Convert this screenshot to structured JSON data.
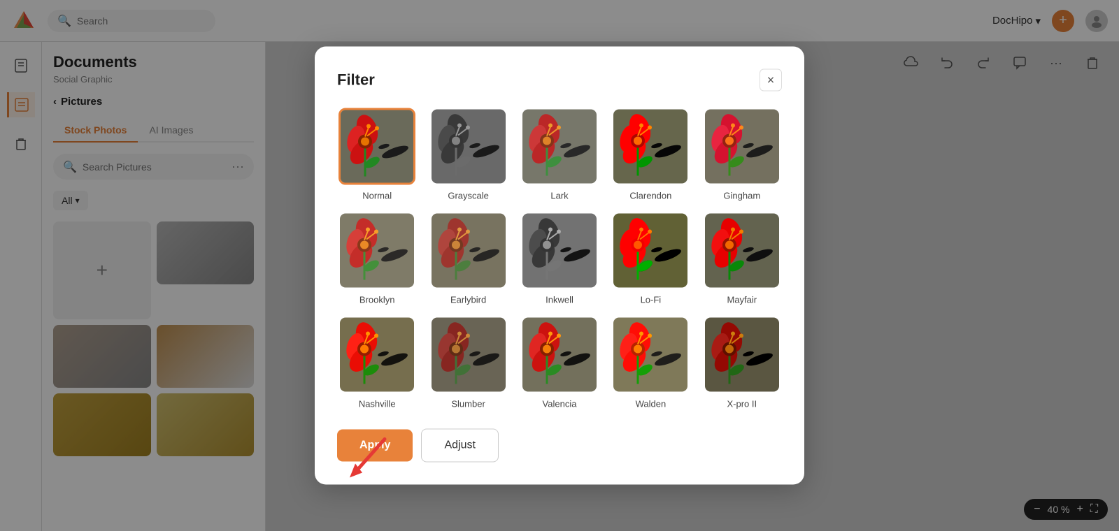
{
  "topbar": {
    "search_placeholder": "Search",
    "brand_name": "DocHipo",
    "brand_chevron": "▾",
    "add_icon": "+",
    "user_icon": "👤"
  },
  "sidebar": {
    "title": "Documents",
    "subtitle": "Social Graphic",
    "back_label": "Pictures",
    "tabs": [
      {
        "id": "stock",
        "label": "Stock Photos",
        "active": true
      },
      {
        "id": "ai",
        "label": "AI Images",
        "active": false
      }
    ],
    "search_placeholder": "Search Pictures",
    "filter_label": "All",
    "images": [
      {
        "id": "horse",
        "class": "img-horse"
      },
      {
        "id": "tiger",
        "class": "img-tiger"
      },
      {
        "id": "flower",
        "class": "img-flower"
      },
      {
        "id": "lion",
        "class": "img-lion"
      },
      {
        "id": "lioness",
        "class": "img-lioness"
      }
    ]
  },
  "modal": {
    "title": "Filter",
    "close_label": "×",
    "filters": [
      {
        "id": "normal",
        "label": "Normal",
        "css_class": "filter-normal",
        "selected": true
      },
      {
        "id": "grayscale",
        "label": "Grayscale",
        "css_class": "filter-grayscale",
        "selected": false
      },
      {
        "id": "lark",
        "label": "Lark",
        "css_class": "filter-lark",
        "selected": false
      },
      {
        "id": "clarendon",
        "label": "Clarendon",
        "css_class": "filter-clarendon",
        "selected": false
      },
      {
        "id": "gingham",
        "label": "Gingham",
        "css_class": "filter-gingham",
        "selected": false
      },
      {
        "id": "brooklyn",
        "label": "Brooklyn",
        "css_class": "filter-brooklyn",
        "selected": false
      },
      {
        "id": "earlybird",
        "label": "Earlybird",
        "css_class": "filter-earlybird",
        "selected": false
      },
      {
        "id": "inkwell",
        "label": "Inkwell",
        "css_class": "filter-inkwell",
        "selected": false
      },
      {
        "id": "lofi",
        "label": "Lo-Fi",
        "css_class": "filter-lofi",
        "selected": false
      },
      {
        "id": "mayfair",
        "label": "Mayfair",
        "css_class": "filter-mayfair",
        "selected": false
      },
      {
        "id": "nashville",
        "label": "Nashville",
        "css_class": "filter-nashville",
        "selected": false
      },
      {
        "id": "slumber",
        "label": "Slumber",
        "css_class": "filter-slumber",
        "selected": false
      },
      {
        "id": "valencia",
        "label": "Valencia",
        "css_class": "filter-valencia",
        "selected": false
      },
      {
        "id": "walden",
        "label": "Walden",
        "css_class": "filter-walden",
        "selected": false
      },
      {
        "id": "xpro2",
        "label": "X-pro II",
        "css_class": "filter-xpro2",
        "selected": false
      }
    ],
    "apply_label": "Apply",
    "adjust_label": "Adjust"
  },
  "canvas": {
    "zoom_level": "40 %"
  }
}
